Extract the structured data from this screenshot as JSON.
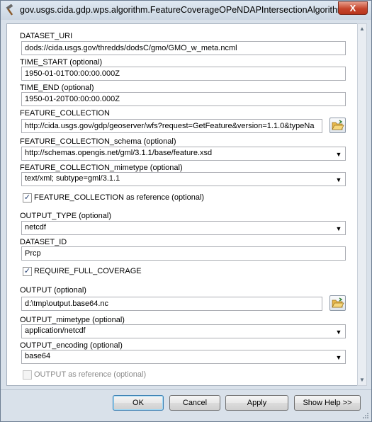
{
  "window": {
    "title": "gov.usgs.cida.gdp.wps.algorithm.FeatureCoverageOPeNDAPIntersectionAlgorithm",
    "close_label": "X"
  },
  "fields": {
    "dataset_uri": {
      "label": "DATASET_URI",
      "value": "dods://cida.usgs.gov/thredds/dodsC/gmo/GMO_w_meta.ncml"
    },
    "time_start": {
      "label": "TIME_START (optional)",
      "value": "1950-01-01T00:00:00.000Z"
    },
    "time_end": {
      "label": "TIME_END (optional)",
      "value": "1950-01-20T00:00:00.000Z"
    },
    "feature_collection": {
      "label": "FEATURE_COLLECTION",
      "value": "http://cida.usgs.gov/gdp/geoserver/wfs?request=GetFeature&version=1.1.0&typeNa"
    },
    "feature_collection_schema": {
      "label": "FEATURE_COLLECTION_schema (optional)",
      "value": "http://schemas.opengis.net/gml/3.1.1/base/feature.xsd"
    },
    "feature_collection_mimetype": {
      "label": "FEATURE_COLLECTION_mimetype (optional)",
      "value": "text/xml; subtype=gml/3.1.1"
    },
    "feature_collection_as_reference": {
      "label": "FEATURE_COLLECTION as reference (optional)",
      "checked": true
    },
    "output_type": {
      "label": "OUTPUT_TYPE (optional)",
      "value": "netcdf"
    },
    "dataset_id": {
      "label": "DATASET_ID",
      "value": "Prcp"
    },
    "require_full_coverage": {
      "label": "REQUIRE_FULL_COVERAGE",
      "checked": true
    },
    "output": {
      "label": "OUTPUT (optional)",
      "value": "d:\\tmp\\output.base64.nc"
    },
    "output_mimetype": {
      "label": "OUTPUT_mimetype (optional)",
      "value": "application/netcdf"
    },
    "output_encoding": {
      "label": "OUTPUT_encoding (optional)",
      "value": "base64"
    },
    "output_as_reference": {
      "label": "OUTPUT as reference (optional)",
      "checked": false,
      "disabled": true
    }
  },
  "buttons": {
    "ok": "OK",
    "cancel": "Cancel",
    "apply": "Apply",
    "show_help": "Show Help >>"
  },
  "icons": {
    "app": "hammer-icon",
    "browse": "folder-open-icon",
    "dropdown": "chevron-down-icon",
    "checkmark": "checkmark-icon"
  },
  "colors": {
    "titlebar": "#cbd6e2",
    "close_button": "#c6452c",
    "panel": "#ffffff",
    "default_button_border": "#3c7fb1"
  }
}
